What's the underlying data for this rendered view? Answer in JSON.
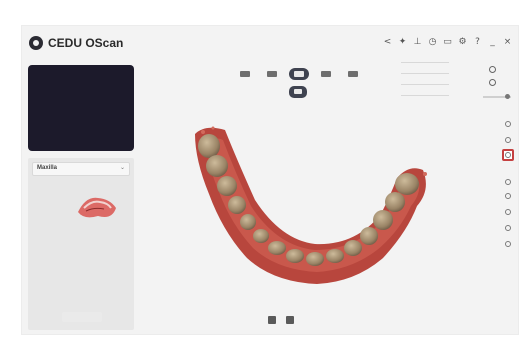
{
  "app": {
    "title": "CEDU OScan"
  },
  "window_controls": [
    {
      "name": "back-icon",
      "glyph": "<"
    },
    {
      "name": "crosshair-icon",
      "glyph": "✦"
    },
    {
      "name": "ruler-icon",
      "glyph": "⊥"
    },
    {
      "name": "history-icon",
      "glyph": "◷"
    },
    {
      "name": "screen-icon",
      "glyph": "▭"
    },
    {
      "name": "settings-icon",
      "glyph": "⚙"
    },
    {
      "name": "help-icon",
      "glyph": "?"
    },
    {
      "name": "minimize-icon",
      "glyph": "_"
    },
    {
      "name": "close-icon",
      "glyph": "×"
    }
  ],
  "side_panel": {
    "jaw_label": "Maxilla",
    "caret": "⌄",
    "info_text": "",
    "info_sub": ""
  },
  "settings": {
    "options": [
      "",
      "",
      "",
      ""
    ],
    "radio_a": "",
    "radio_b": ""
  },
  "colors": {
    "accent": "#c54040",
    "dark": "#1c1a2b",
    "scan_tissue": "#b8463d",
    "scan_teeth": "#a89478"
  }
}
